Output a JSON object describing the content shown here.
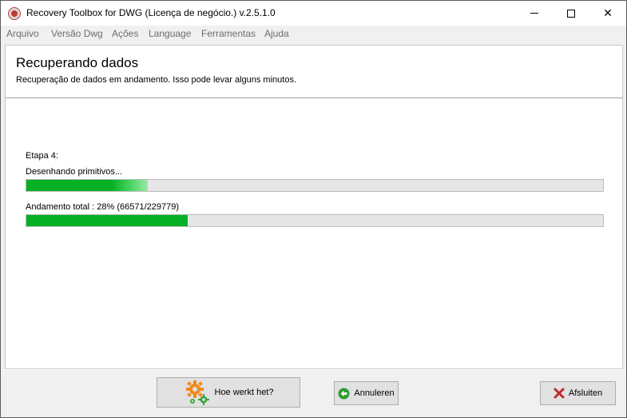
{
  "window": {
    "title": "Recovery Toolbox for DWG (Licença de negócio.) v.2.5.1.0",
    "icon": "recovery-toolbox-icon"
  },
  "menu": {
    "items": [
      "Arquivo",
      "Versão Dwg",
      "Ações",
      "Language",
      "Ferramentas",
      "Ajuda"
    ]
  },
  "header": {
    "title": "Recuperando dados",
    "subtitle": "Recuperação de dados em andamento. Isso pode levar alguns minutos."
  },
  "progress": {
    "stage_label": "Etapa 4:",
    "step_label": "Desenhando primitivos...",
    "step_fraction": 0.21,
    "total_label": "Andamento total : 28% (66571/229779)",
    "total_fraction": 0.28,
    "bar_color": "#06b025"
  },
  "buttons": {
    "help_label": "Hoe werkt het?",
    "help_icon": "gears-icon",
    "cancel_label": "Annuleren",
    "cancel_icon": "back-arrow-icon",
    "exit_label": "Afsluiten",
    "exit_icon": "red-x-icon"
  }
}
